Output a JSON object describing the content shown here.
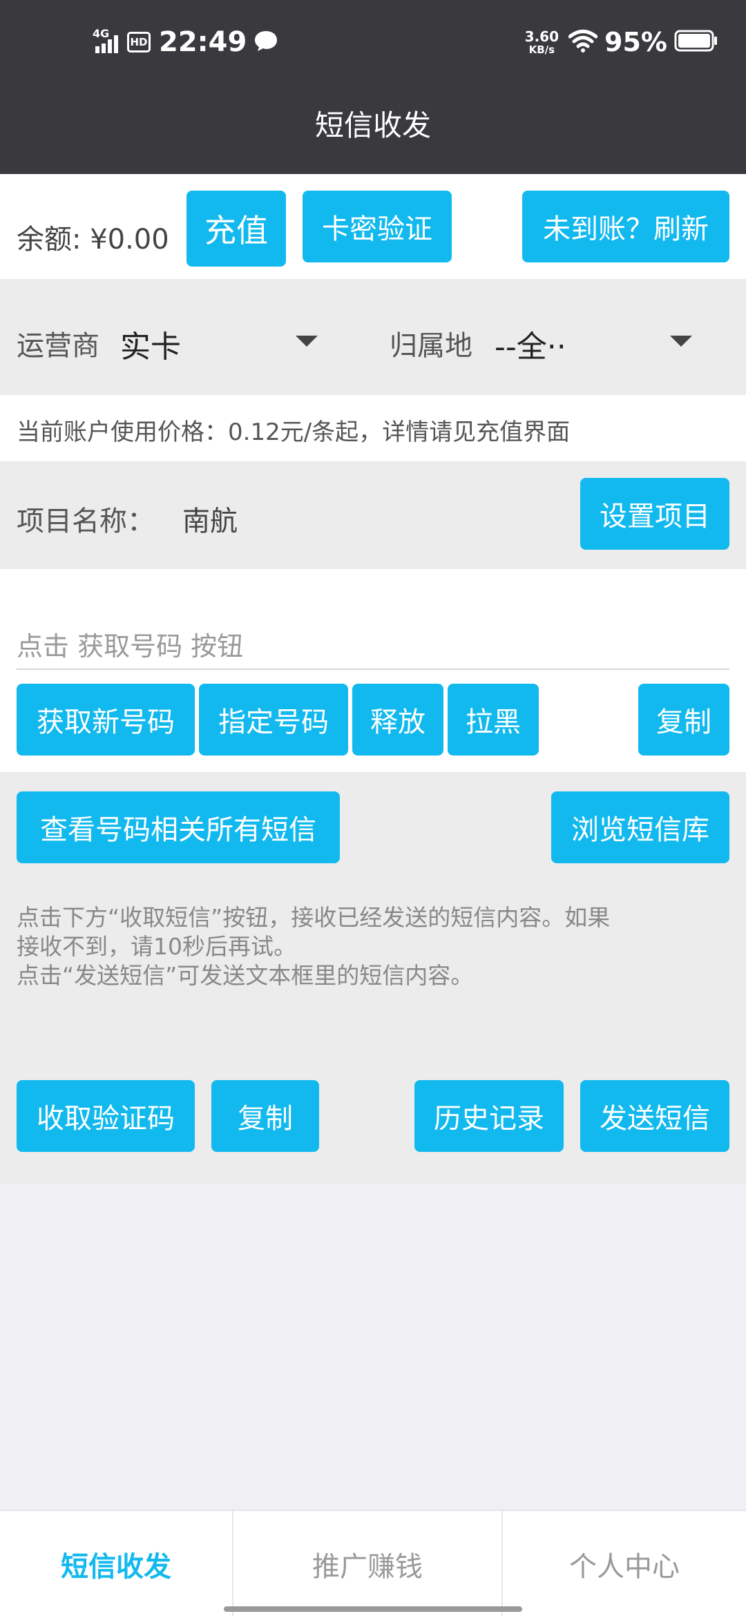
{
  "status_bar": {
    "network": "4G",
    "hd": "HD",
    "time": "22:49",
    "net_speed_value": "3.60",
    "net_speed_unit": "KB/s",
    "battery_pct": "95%"
  },
  "nav": {
    "title": "短信收发"
  },
  "balance_row": {
    "balance_label": "余额: ¥0.00",
    "recharge_label": "充值",
    "card_verify_label": "卡密验证",
    "refresh_label": "未到账？刷新"
  },
  "carrier_row": {
    "carrier_label": "运营商",
    "carrier_value": "实卡",
    "region_label": "归属地",
    "region_value": "--全··"
  },
  "price_note": "当前账户使用价格：0.12元/条起，详情请见充值界面",
  "project_row": {
    "label": "项目名称：",
    "value": "南航",
    "set_project_label": "设置项目"
  },
  "number_section": {
    "input_placeholder": "点击 获取号码 按钮",
    "input_value": "",
    "get_new_label": "获取新号码",
    "specify_label": "指定号码",
    "release_label": "释放",
    "blacklist_label": "拉黑",
    "copy_label": "复制"
  },
  "sms_section": {
    "view_all_label": "查看号码相关所有短信",
    "browse_lib_label": "浏览短信库",
    "hint_line1": "点击下方“收取短信”按钮，接收已经发送的短信内容。如果",
    "hint_line2": "接收不到，请10秒后再试。",
    "hint_line3": "点击“发送短信”可发送文本框里的短信内容。",
    "receive_code_label": "收取验证码",
    "copy_label": "复制",
    "history_label": "历史记录",
    "send_sms_label": "发送短信"
  },
  "tabbar": {
    "tabs": [
      {
        "label": "短信收发"
      },
      {
        "label": "推广赚钱"
      },
      {
        "label": "个人中心"
      }
    ]
  },
  "colors": {
    "accent": "#12b9ee",
    "header_bg": "#3a3a3e",
    "page_bg": "#efeff4"
  }
}
